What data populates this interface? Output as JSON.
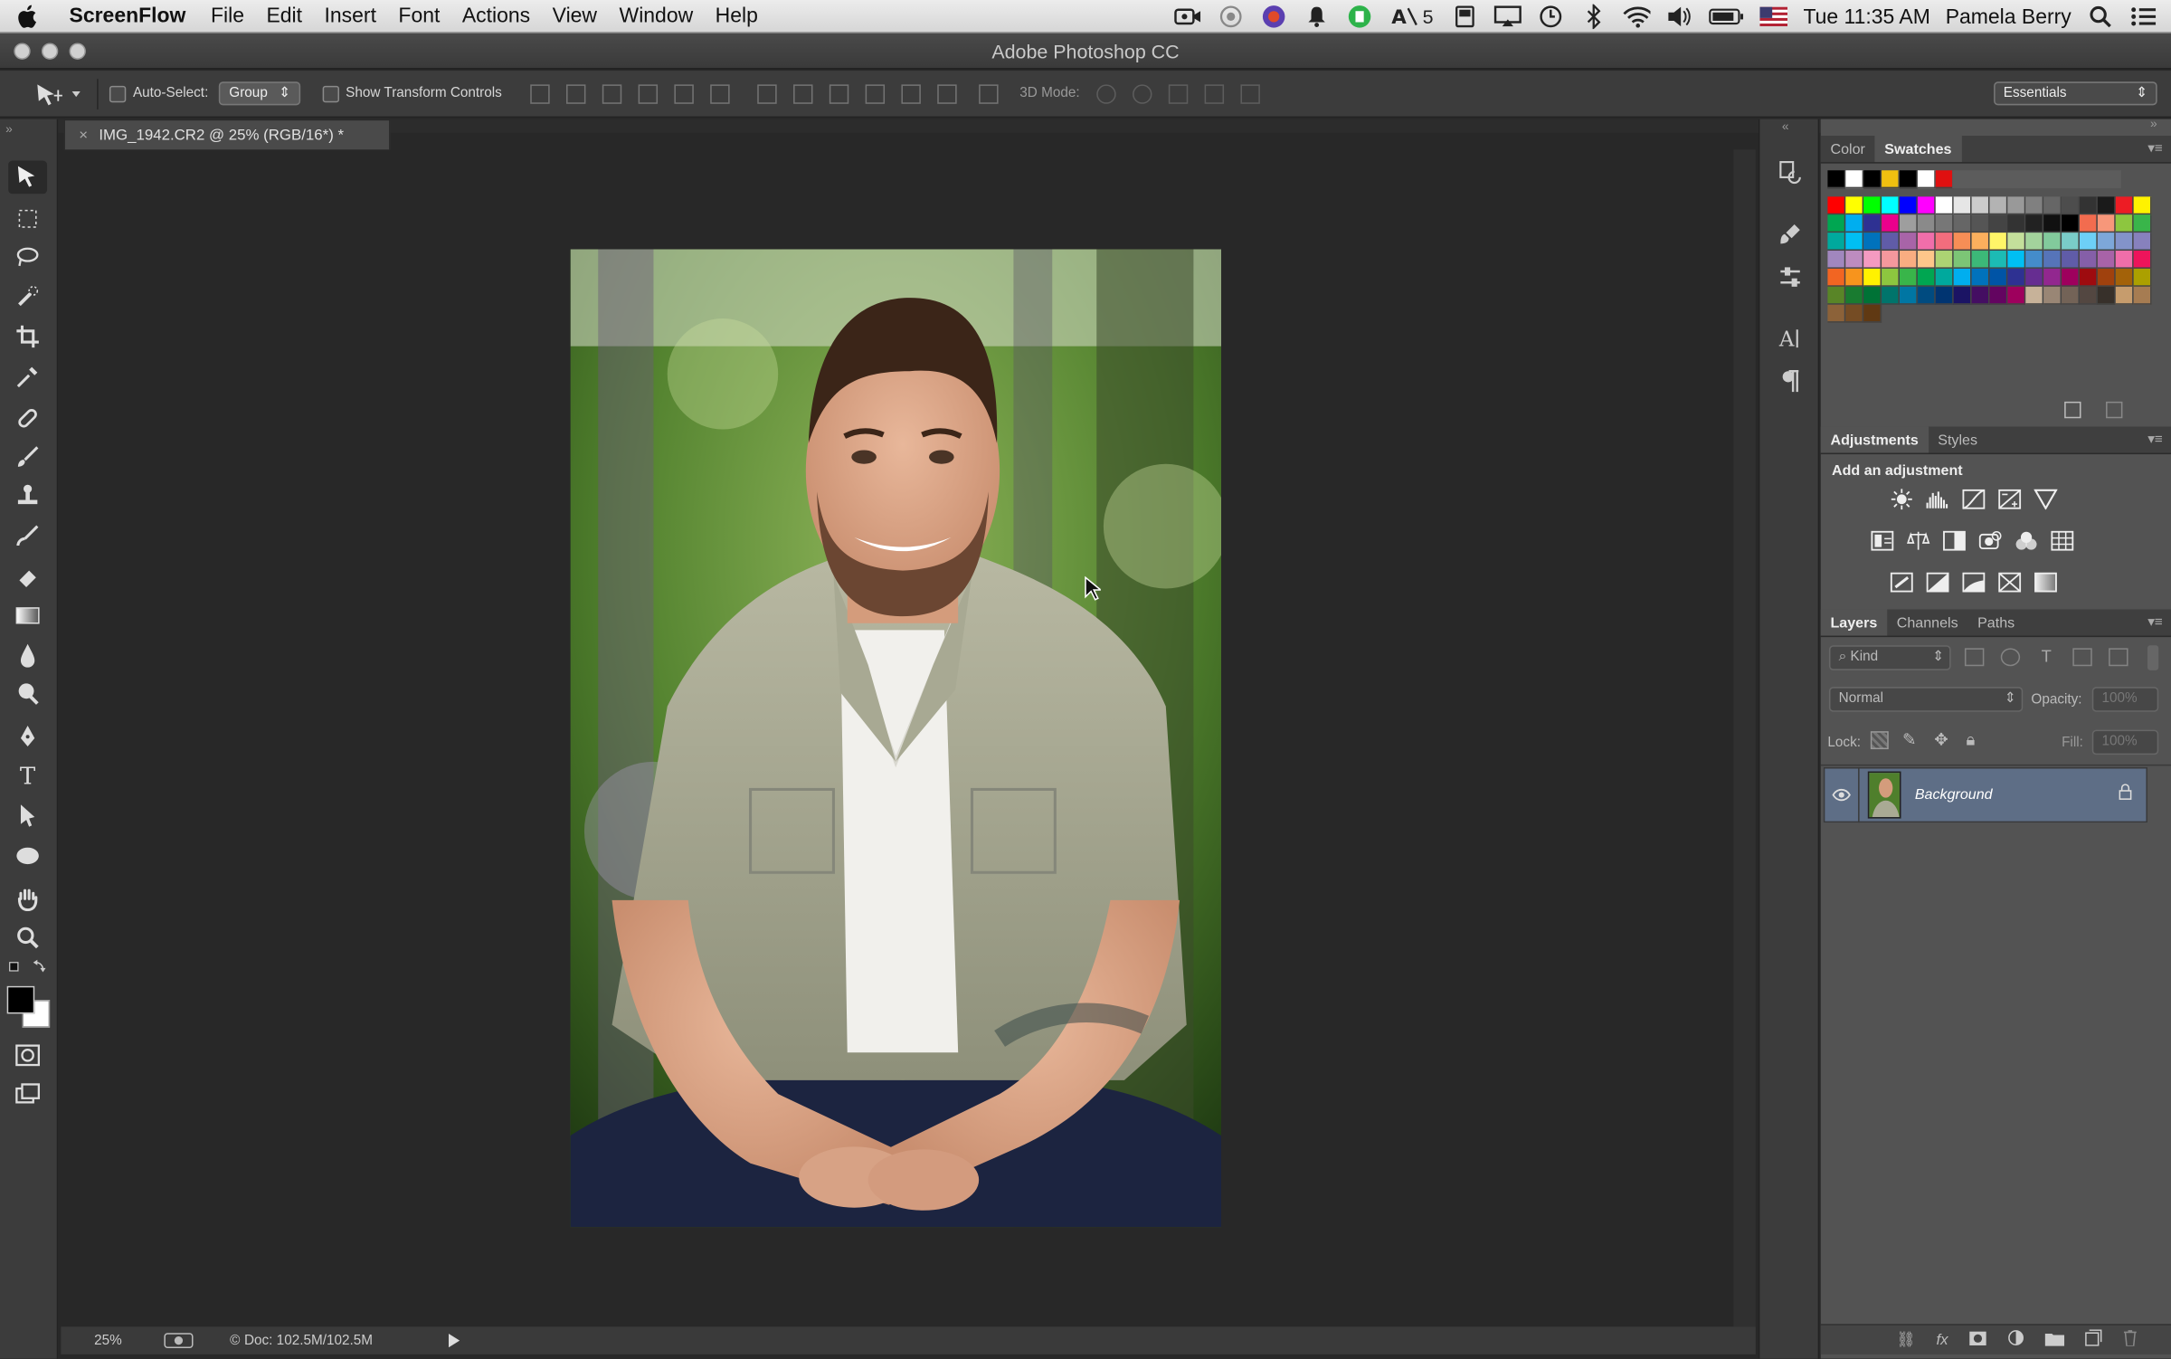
{
  "menubar": {
    "app_name": "ScreenFlow",
    "items": [
      "File",
      "Edit",
      "Insert",
      "Font",
      "Actions",
      "View",
      "Window",
      "Help"
    ],
    "right": {
      "clock": "Tue 11:35 AM",
      "user": "Pamela Berry",
      "badge": "5"
    }
  },
  "window": {
    "title": "Adobe Photoshop CC"
  },
  "options_bar": {
    "auto_select_label": "Auto-Select:",
    "auto_select_value": "Group",
    "show_transform_label": "Show Transform Controls",
    "mode_3d_label": "3D Mode:",
    "workspace": "Essentials"
  },
  "document": {
    "tab_title": "IMG_1942.CR2 @ 25% (RGB/16*) *",
    "zoom": "25%",
    "doc_size": "Doc: 102.5M/102.5M"
  },
  "color_panel": {
    "tabs": [
      "Color",
      "Swatches"
    ],
    "active_tab": "Swatches",
    "recent": [
      "#000000",
      "#ffffff",
      "#000000",
      "#f0c010",
      "#000000",
      "#ffffff",
      "#e01010"
    ],
    "swatches": [
      "#ff0000",
      "#ffff00",
      "#00ff00",
      "#00ffff",
      "#0000ff",
      "#ff00ff",
      "#ffffff",
      "#e6e6e6",
      "#cccccc",
      "#b3b3b3",
      "#999999",
      "#808080",
      "#666666",
      "#4d4d4d",
      "#333333",
      "#1a1a1a",
      "#ed1c24",
      "#fff200",
      "#00a651",
      "#00aeef",
      "#2e3192",
      "#ec008c",
      "#9e9e9e",
      "#8a8a8a",
      "#777777",
      "#666666",
      "#555555",
      "#444444",
      "#333333",
      "#222222",
      "#111111",
      "#000000",
      "#f26c4f",
      "#f7977a",
      "#8dc63f",
      "#39b54a",
      "#00a99d",
      "#00bff3",
      "#0072bc",
      "#605ca8",
      "#a864a8",
      "#f06eaa",
      "#f26d7d",
      "#f68e56",
      "#fbaf5d",
      "#fff568",
      "#c4df9b",
      "#a3d39c",
      "#82ca9c",
      "#7accc8",
      "#6dcff6",
      "#7da7d9",
      "#8393ca",
      "#8781bd",
      "#a187be",
      "#bd8cbf",
      "#f49ac1",
      "#f5989d",
      "#f9ad81",
      "#fdc68a",
      "#acd373",
      "#7cc576",
      "#3cb878",
      "#1cbbb4",
      "#00bff3",
      "#448ccb",
      "#5674b9",
      "#605ca8",
      "#855fa8",
      "#a863a8",
      "#f06eaa",
      "#ed145b",
      "#f26522",
      "#f7941d",
      "#fff200",
      "#8dc63f",
      "#39b54a",
      "#00a651",
      "#00a99d",
      "#00aeef",
      "#0072bc",
      "#0054a6",
      "#2e3192",
      "#662d91",
      "#92278f",
      "#9e005d",
      "#9e0b0f",
      "#a0410d",
      "#a36209",
      "#aba000",
      "#598527",
      "#197b30",
      "#007236",
      "#00746b",
      "#0076a3",
      "#004b80",
      "#003471",
      "#1b1464",
      "#440e62",
      "#630460",
      "#9e005d",
      "#c7b299",
      "#998675",
      "#736357",
      "#534741",
      "#37302a",
      "#c69c6d",
      "#a67c52",
      "#8c6239",
      "#754c24",
      "#603913"
    ]
  },
  "adjustments_panel": {
    "tabs": [
      "Adjustments",
      "Styles"
    ],
    "active_tab": "Adjustments",
    "heading": "Add an adjustment"
  },
  "layers_panel": {
    "tabs": [
      "Layers",
      "Channels",
      "Paths"
    ],
    "active_tab": "Layers",
    "filter_kind": "Kind",
    "blend_mode": "Normal",
    "opacity_label": "Opacity:",
    "opacity_value": "100%",
    "lock_label": "Lock:",
    "fill_label": "Fill:",
    "fill_value": "100%",
    "layers": [
      {
        "name": "Background",
        "visible": true,
        "locked": true
      }
    ]
  },
  "colors": {
    "fg": "#000000",
    "bg": "#ffffff",
    "selected_layer": "#5e6e86"
  }
}
